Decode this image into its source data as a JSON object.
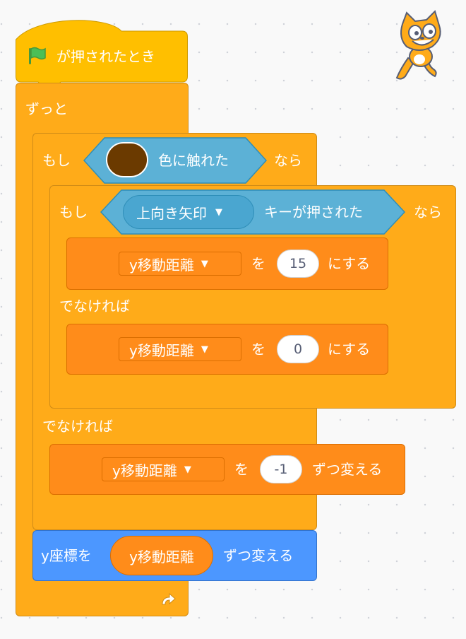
{
  "hat": {
    "label": "が押されたとき",
    "icon": "green-flag-icon"
  },
  "forever": {
    "label": "ずっと",
    "icon": "loop-arrow-icon"
  },
  "if_touching": {
    "if_label": "もし",
    "color_value": "#6b3a00",
    "condition_label": "色に触れた",
    "then_label": "なら",
    "else_label": "でなければ"
  },
  "if_key": {
    "if_label": "もし",
    "key_value": "上向き矢印",
    "condition_label": "キーが押された",
    "then_label": "なら",
    "else_label": "でなければ"
  },
  "set_var_1": {
    "variable": "y移動距離",
    "to_label": "を",
    "value": "15",
    "suffix": "にする"
  },
  "set_var_2": {
    "variable": "y移動距離",
    "to_label": "を",
    "value": "0",
    "suffix": "にする"
  },
  "change_var": {
    "variable": "y移動距離",
    "by_label": "を",
    "value": "-1",
    "suffix": "ずつ変える"
  },
  "change_y": {
    "label": "y座標を",
    "reporter": "y移動距離",
    "suffix": "ずつ変える"
  },
  "colors": {
    "control": "#ffab19",
    "variables": "#ff8c1a",
    "sensing": "#5cb1d6",
    "motion": "#4c97ff"
  }
}
